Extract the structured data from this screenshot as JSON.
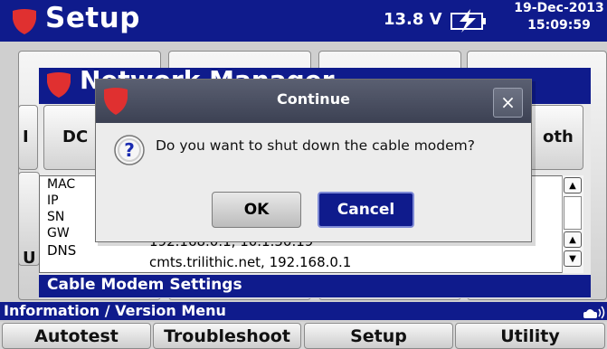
{
  "header": {
    "title": "Setup",
    "voltage": "13.8 V",
    "date": "19-Dec-2013",
    "time": "15:09:59"
  },
  "network_manager": {
    "title": "Network Manager",
    "buttons": {
      "left_partial": "I",
      "dc": "DC",
      "both": "oth"
    },
    "partial_u": "U",
    "rows": [
      {
        "label": "MAC",
        "value": ""
      },
      {
        "label": "IP",
        "value": ""
      },
      {
        "label": "SN",
        "value": ""
      },
      {
        "label": "GW",
        "value": "192.168.0.1, 10.1.50.19"
      },
      {
        "label": "DNS",
        "value": "cmts.trilithic.net, 192.168.0.1"
      }
    ],
    "section_label": "Cable Modem Settings"
  },
  "info_bar": {
    "label": "Information / Version Menu"
  },
  "bottom_tabs": [
    "Autotest",
    "Troubleshoot",
    "Setup",
    "Utility"
  ],
  "dialog": {
    "title": "Continue",
    "close": "×",
    "message": "Do you want to shut down the cable modem?",
    "ok": "OK",
    "cancel": "Cancel"
  },
  "colors": {
    "header_blue": "#0f1b8c",
    "brand_red": "#e03030"
  }
}
